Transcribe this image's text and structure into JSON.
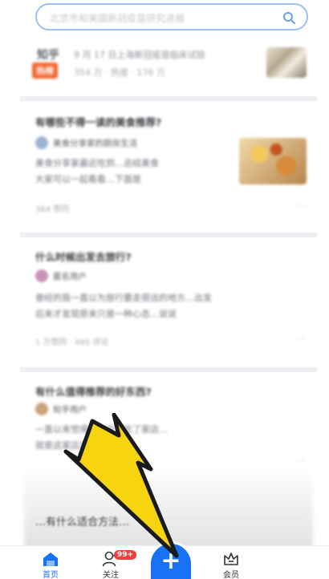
{
  "search": {
    "placeholder": "北京市和美国新冠疫苗研究进展"
  },
  "hot_card": {
    "logo": "知乎",
    "badge": "热榜",
    "title": "9 月 17 日上海新冠疫苗临床试验",
    "meta": "354 万 · 热度 · 176 万"
  },
  "feed": [
    {
      "question": "有哪些不得一读的美食推荐?",
      "author": "美食分享家的厨房生活",
      "excerpt_lines": [
        "美食分享家最近吃到…总结美食",
        "大家可以一起看看…下面是"
      ],
      "meta": "364 赞同",
      "more": "···"
    },
    {
      "question": "什么时候出发去旅行?",
      "author": "匿名用户",
      "excerpt_lines": [
        "曾经的我一直以为旅行要走很远的地方…出发",
        "后来才发现原来只是一种心态…说说"
      ],
      "meta": "1 万赞同 · 485 评论",
      "more": "···"
    },
    {
      "question": "有什么值得推荐的好东西?",
      "author": "知乎用户",
      "excerpt_lines": [
        "一直以来觉得…上次去吃了家店…",
        "就是这家店真的…推荐"
      ],
      "meta": "",
      "more": "···"
    }
  ],
  "bottom_snippet": "…有什么适合方法…",
  "tabs": {
    "home": "首页",
    "follow": "关注",
    "follow_badge": "99+",
    "member": "会员"
  },
  "create_button": {
    "icon": "plus-icon",
    "symbol": "+"
  },
  "colors": {
    "accent": "#1772f6",
    "hot_badge": "#f2662e",
    "notification_badge": "#f1403c",
    "arrow": "#f6d40f"
  }
}
